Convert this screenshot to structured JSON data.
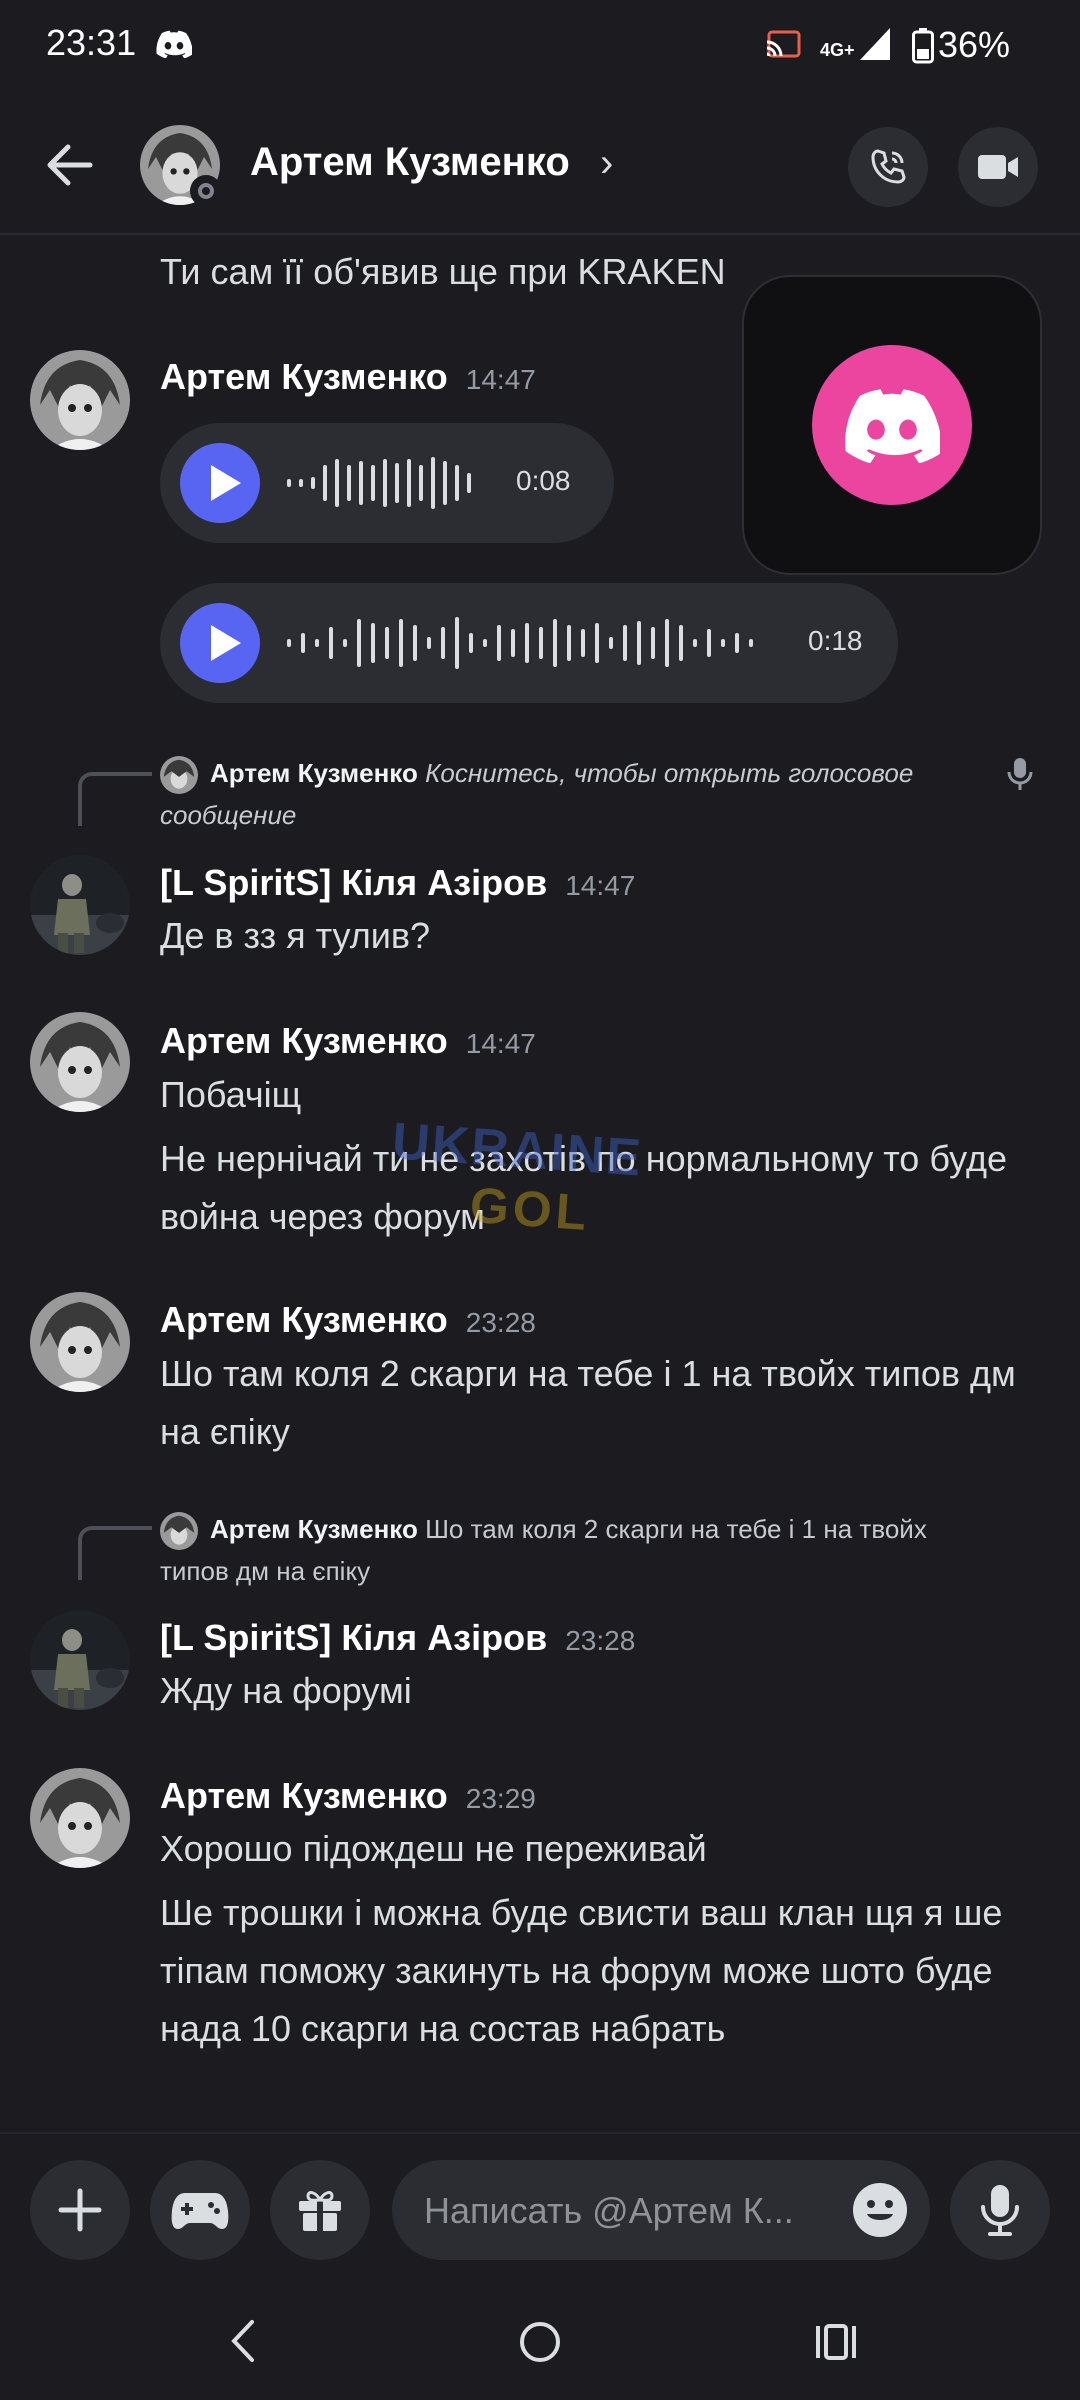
{
  "status_bar": {
    "time": "23:31",
    "network": "4G+",
    "battery": "36%"
  },
  "header": {
    "title": "Артем Кузменко",
    "chevron": "›"
  },
  "messages": [
    {
      "type": "continuation",
      "text": "Ти сам її об'явив ще при KRAKEN"
    },
    {
      "author": "Артем Кузменко",
      "time": "14:47",
      "voice": [
        {
          "duration": "0:08"
        },
        {
          "duration": "0:18"
        }
      ]
    },
    {
      "reply": {
        "author": "Артем Кузменко",
        "text": "Коснитесь, чтобы открыть голосовое сообщение"
      },
      "author": "[L SpiritS] Кіля Азіров",
      "time": "14:47",
      "lines": [
        "Де в зз я тулив?"
      ]
    },
    {
      "author": "Артем Кузменко",
      "time": "14:47",
      "lines": [
        "Побачіщ",
        "Не нернічай ти не захотів по нормальному то буде война через форум"
      ]
    },
    {
      "author": "Артем Кузменко",
      "time": "23:28",
      "lines": [
        "Шо там коля 2 скарги на тебе і 1 на твойх типов дм на єпіку"
      ]
    },
    {
      "reply": {
        "author": "Артем Кузменко",
        "text": "Шо там коля 2 скарги на тебе і 1 на твойх типов дм на єпіку"
      },
      "author": "[L SpiritS] Кіля Азіров",
      "time": "23:28",
      "lines": [
        "Жду на форумі"
      ]
    },
    {
      "author": "Артем Кузменко",
      "time": "23:29",
      "lines": [
        "Хорошо підождеш не переживай",
        "Ше трошки і можна буде свисти ваш клан щя я ше тіпам поможу закинуть на форум може шото буде  нада 10 скарги на состав набрать"
      ]
    }
  ],
  "watermark": {
    "line1": "UKRAINE",
    "line2": "GOL"
  },
  "input": {
    "placeholder": "Написать @Артем К..."
  },
  "icons": {
    "back": "arrow-left-icon",
    "call": "phone-icon",
    "video": "video-camera-icon",
    "plus": "plus-icon",
    "games": "gamepad-icon",
    "gift": "gift-icon",
    "emoji": "emoji-icon",
    "mic": "microphone-icon"
  },
  "colors": {
    "background": "#1b1b20",
    "accent": "#5865f2",
    "discord_pink": "#eb459f"
  }
}
